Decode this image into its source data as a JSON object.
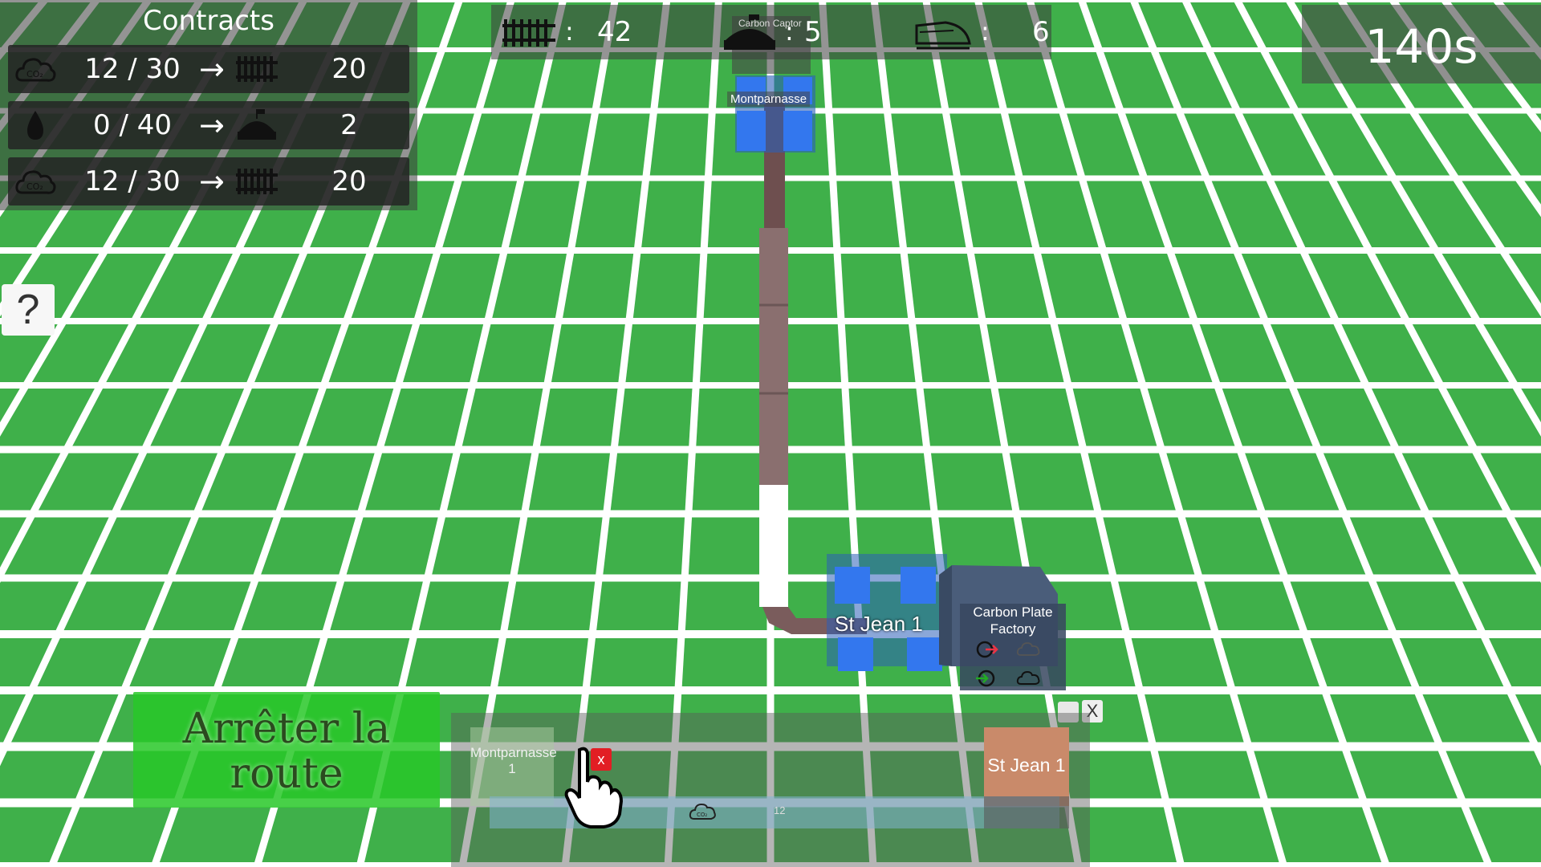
{
  "contracts": {
    "title": "Contracts",
    "rows": [
      {
        "resource_icon": "co2-cloud-icon",
        "progress": "12 / 30",
        "arrow": "→",
        "reward_icon": "rail-track-icon",
        "reward": "20"
      },
      {
        "resource_icon": "water-drop-icon",
        "progress": "0 / 40",
        "arrow": "→",
        "reward_icon": "carbon-captor-icon",
        "reward": "2"
      },
      {
        "resource_icon": "co2-cloud-icon",
        "progress": "12 / 30",
        "arrow": "→",
        "reward_icon": "rail-track-icon",
        "reward": "20"
      }
    ]
  },
  "counters": {
    "rails": {
      "icon": "rail-track-icon",
      "sep": ":",
      "value": "42"
    },
    "captors": {
      "icon": "carbon-captor-icon",
      "sep": ":",
      "value": "5"
    },
    "trains": {
      "icon": "train-icon",
      "sep": ":",
      "value": "6"
    }
  },
  "timer": "140s",
  "help_label": "?",
  "stop_route_label": "Arrêter la route",
  "world": {
    "station_montparnasse": "Montparnasse",
    "carbon_captor_label": "Carbon Captor",
    "station_stjean": "St Jean 1",
    "factory_name": "Carbon Plate Factory"
  },
  "route_editor": {
    "stop_a": "Montparnasse 1",
    "stop_b": "St Jean 1",
    "remove_label": "x",
    "cargo_icon": "co2-cloud-icon",
    "cargo_qty": "12",
    "close_label": "X"
  },
  "colors": {
    "grass": "#3fb04a",
    "grid_lines": "#ffffff",
    "rail": "#7d6060",
    "station_blocks": "#3377ee",
    "stop_button": "#28c828",
    "remove_red": "#e21e24"
  }
}
